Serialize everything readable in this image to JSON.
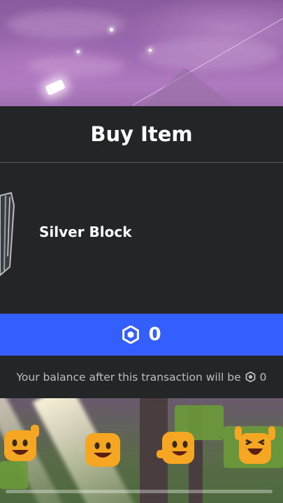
{
  "dialog": {
    "title": "Buy Item",
    "item_name": "Silver Block",
    "price": "0",
    "balance_text": "Your balance after this transaction will be",
    "balance_value": "0"
  },
  "icons": {
    "currency": "robux-icon",
    "item": "silver-block-icon",
    "emojis": [
      "waving-emoji-icon",
      "grinning-emoji-icon",
      "pointing-emoji-icon",
      "cheering-emoji-icon"
    ]
  },
  "colors": {
    "buy_button": "#335fff",
    "dialog_bg": "#232527"
  }
}
